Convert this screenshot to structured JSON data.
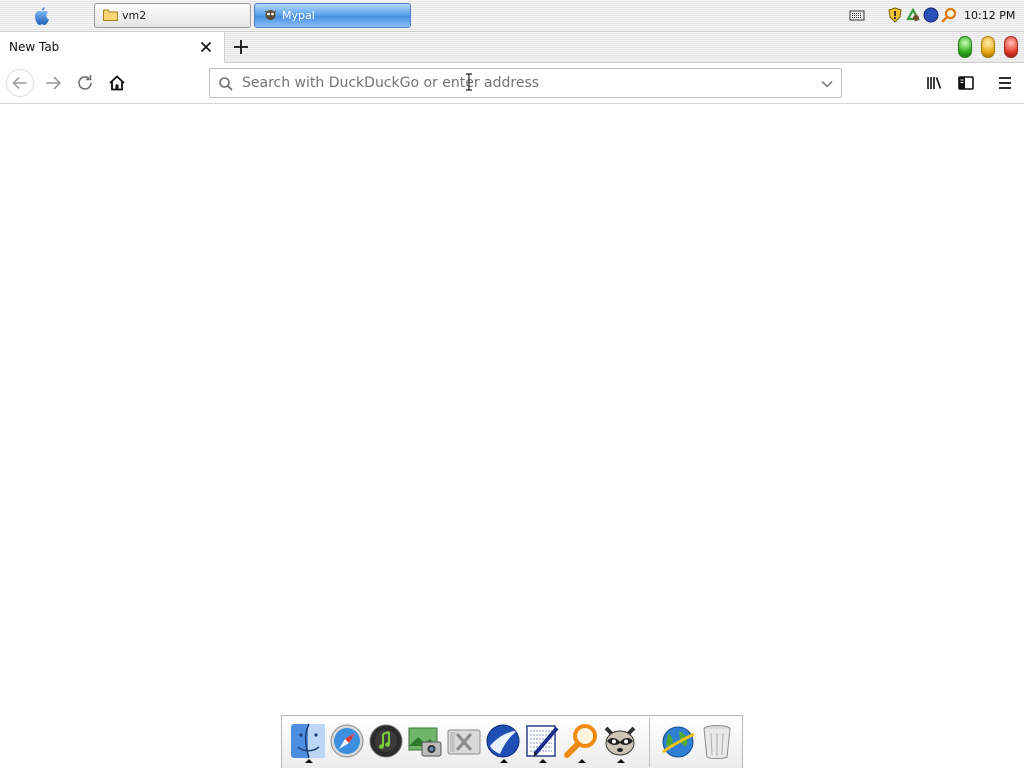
{
  "system_panel": {
    "apple_menu_icon": "apple-logo-icon",
    "taskbar": [
      {
        "label": "vm2",
        "icon": "folder-icon",
        "active": false
      },
      {
        "label": "Mypal",
        "icon": "mypal-icon",
        "active": true
      }
    ],
    "tray_icons": [
      "keyboard-icon",
      "shield-icon",
      "recycle-icon",
      "compass-icon",
      "search-icon"
    ],
    "clock": "10:12 PM"
  },
  "browser": {
    "tabs": [
      {
        "label": "New Tab",
        "active": true
      }
    ],
    "window_lights": {
      "green": "#2fae1c",
      "yellow": "#e8a712",
      "red": "#e33a2a"
    },
    "navbar": {
      "buttons": [
        "back-icon",
        "forward-icon",
        "reload-icon",
        "home-icon"
      ],
      "url_placeholder": "Search with DuckDuckGo or enter address",
      "url_value": "",
      "right_buttons": [
        "library-icon",
        "sidebar-icon",
        "menu-icon"
      ]
    }
  },
  "dock": {
    "items": [
      {
        "icon": "finder-icon",
        "running": true
      },
      {
        "icon": "safari-compass-icon",
        "running": false
      },
      {
        "icon": "itunes-icon",
        "running": false
      },
      {
        "icon": "photo-camera-icon",
        "running": false
      },
      {
        "icon": "system-tools-icon",
        "running": false
      },
      {
        "icon": "mypal-browser-icon",
        "running": true
      },
      {
        "icon": "text-editor-icon",
        "running": true
      },
      {
        "icon": "magnifier-search-icon",
        "running": true
      },
      {
        "icon": "raccoon-icon",
        "running": true
      },
      {
        "icon": "network-globe-icon",
        "running": false
      },
      {
        "icon": "trash-icon",
        "running": false
      }
    ]
  }
}
